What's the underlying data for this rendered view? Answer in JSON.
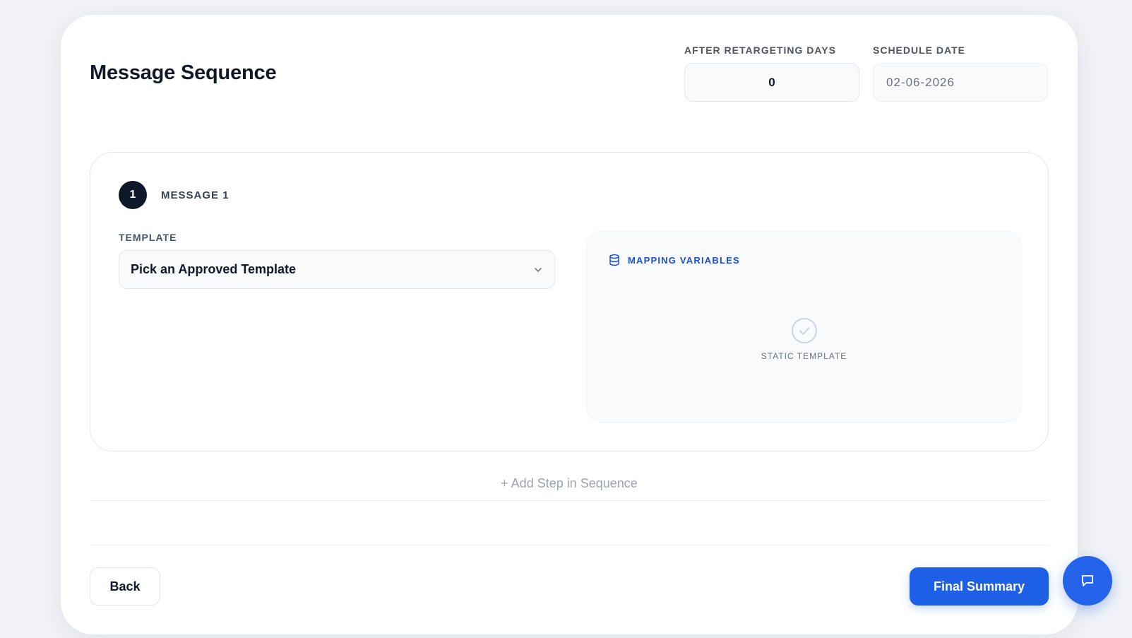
{
  "page": {
    "title": "Message Sequence"
  },
  "header": {
    "retargeting": {
      "label": "AFTER RETARGETING DAYS",
      "value": "0"
    },
    "schedule": {
      "label": "SCHEDULE DATE",
      "value": "02-06-2026"
    }
  },
  "message": {
    "number": "1",
    "title": "MESSAGE 1",
    "template": {
      "label": "TEMPLATE",
      "selected": "Pick an Approved Template"
    },
    "mapping": {
      "title": "MAPPING VARIABLES",
      "empty_state": "STATIC TEMPLATE"
    }
  },
  "actions": {
    "add_step": "+ Add Step in Sequence",
    "back": "Back",
    "final_summary": "Final Summary"
  },
  "colors": {
    "primary": "#1d5fe5",
    "badge": "#0f172a",
    "mapping_accent": "#1d4ed8"
  },
  "icons": {
    "mapping": "database-icon",
    "static": "check-circle-icon",
    "chat": "chat-bubble-icon",
    "select": "chevron-down-icon"
  }
}
